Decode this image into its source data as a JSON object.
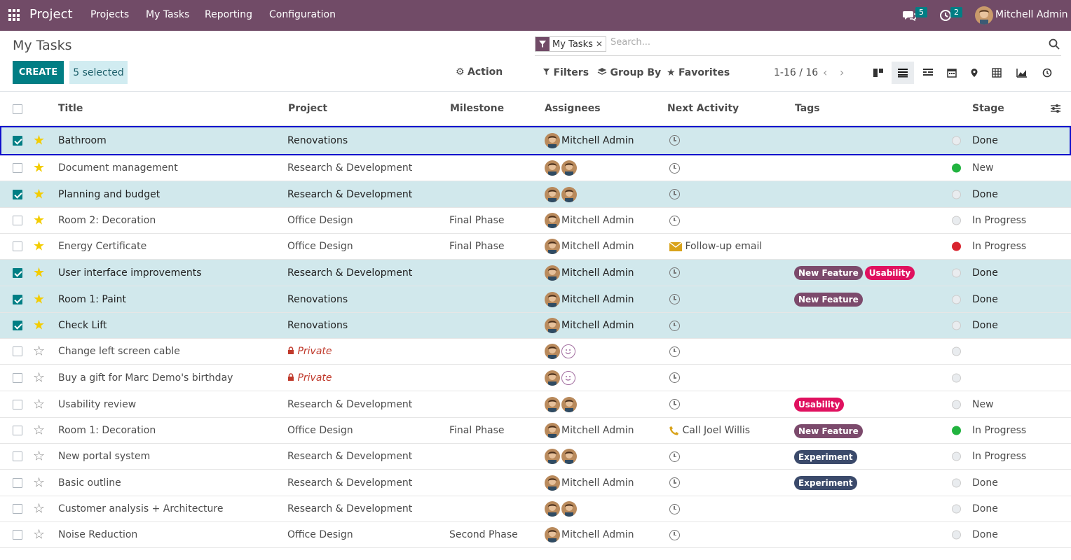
{
  "navbar": {
    "brand": "Project",
    "menus": [
      "Projects",
      "My Tasks",
      "Reporting",
      "Configuration"
    ],
    "messages_count": "5",
    "activities_count": "2",
    "user": "Mitchell Admin"
  },
  "control": {
    "title": "My Tasks",
    "create_label": "CREATE",
    "selected_label": "5 selected",
    "action_label": "Action",
    "facet_label": "My Tasks",
    "search_placeholder": "Search...",
    "filters_label": "Filters",
    "groupby_label": "Group By",
    "favorites_label": "Favorites",
    "pager": "1-16 / 16"
  },
  "columns": {
    "title": "Title",
    "project": "Project",
    "milestone": "Milestone",
    "assignees": "Assignees",
    "next_activity": "Next Activity",
    "tags": "Tags",
    "stage": "Stage"
  },
  "colors": {
    "brand": "#714b67",
    "accent": "#017e84",
    "tag_new_feature": "#7c4a6c",
    "tag_usability": "#e0115f",
    "tag_experiment": "#3b4a6b"
  },
  "rows": [
    {
      "selected": true,
      "starred": true,
      "title": "Bathroom",
      "project": "Renovations",
      "private": false,
      "milestone": "",
      "assignee_name": "Mitchell Admin",
      "assignee_count": 1,
      "activity_type": "clock",
      "activity": "",
      "tags": [],
      "status": "grey",
      "stage": "Done"
    },
    {
      "selected": false,
      "starred": true,
      "title": "Document management",
      "project": "Research & Development",
      "private": false,
      "milestone": "",
      "assignee_name": "",
      "assignee_count": 2,
      "activity_type": "clock",
      "activity": "",
      "tags": [],
      "status": "green",
      "stage": "New"
    },
    {
      "selected": true,
      "starred": true,
      "title": "Planning and budget",
      "project": "Research & Development",
      "private": false,
      "milestone": "",
      "assignee_name": "",
      "assignee_count": 2,
      "activity_type": "clock",
      "activity": "",
      "tags": [],
      "status": "grey",
      "stage": "Done"
    },
    {
      "selected": false,
      "starred": true,
      "title": "Room 2: Decoration",
      "project": "Office Design",
      "private": false,
      "milestone": "Final Phase",
      "assignee_name": "Mitchell Admin",
      "assignee_count": 1,
      "activity_type": "clock",
      "activity": "",
      "tags": [],
      "status": "grey",
      "stage": "In Progress"
    },
    {
      "selected": false,
      "starred": true,
      "title": "Energy Certificate",
      "project": "Office Design",
      "private": false,
      "milestone": "Final Phase",
      "assignee_name": "Mitchell Admin",
      "assignee_count": 1,
      "activity_type": "email",
      "activity": "Follow-up email",
      "tags": [],
      "status": "red",
      "stage": "In Progress"
    },
    {
      "selected": true,
      "starred": true,
      "title": "User interface improvements",
      "project": "Research & Development",
      "private": false,
      "milestone": "",
      "assignee_name": "Mitchell Admin",
      "assignee_count": 1,
      "activity_type": "clock",
      "activity": "",
      "tags": [
        "New Feature",
        "Usability"
      ],
      "status": "grey",
      "stage": "Done"
    },
    {
      "selected": true,
      "starred": true,
      "title": "Room 1: Paint",
      "project": "Renovations",
      "private": false,
      "milestone": "",
      "assignee_name": "Mitchell Admin",
      "assignee_count": 1,
      "activity_type": "clock",
      "activity": "",
      "tags": [
        "New Feature"
      ],
      "status": "grey",
      "stage": "Done"
    },
    {
      "selected": true,
      "starred": true,
      "title": "Check Lift",
      "project": "Renovations",
      "private": false,
      "milestone": "",
      "assignee_name": "Mitchell Admin",
      "assignee_count": 1,
      "activity_type": "clock",
      "activity": "",
      "tags": [],
      "status": "grey",
      "stage": "Done"
    },
    {
      "selected": false,
      "starred": false,
      "title": "Change left screen cable",
      "project": "Private",
      "private": true,
      "milestone": "",
      "assignee_name": "",
      "assignee_count": 2,
      "smiley": true,
      "activity_type": "clock",
      "activity": "",
      "tags": [],
      "status": "grey",
      "stage": ""
    },
    {
      "selected": false,
      "starred": false,
      "title": "Buy a gift for Marc Demo's birthday",
      "project": "Private",
      "private": true,
      "milestone": "",
      "assignee_name": "",
      "assignee_count": 2,
      "smiley": true,
      "activity_type": "clock",
      "activity": "",
      "tags": [],
      "status": "grey",
      "stage": ""
    },
    {
      "selected": false,
      "starred": false,
      "title": "Usability review",
      "project": "Research & Development",
      "private": false,
      "milestone": "",
      "assignee_name": "",
      "assignee_count": 2,
      "activity_type": "clock",
      "activity": "",
      "tags": [
        "Usability"
      ],
      "status": "grey",
      "stage": "New"
    },
    {
      "selected": false,
      "starred": false,
      "title": "Room 1: Decoration",
      "project": "Office Design",
      "private": false,
      "milestone": "Final Phase",
      "assignee_name": "Mitchell Admin",
      "assignee_count": 1,
      "activity_type": "phone",
      "activity": "Call Joel Willis",
      "tags": [
        "New Feature"
      ],
      "status": "green",
      "stage": "In Progress"
    },
    {
      "selected": false,
      "starred": false,
      "title": "New portal system",
      "project": "Research & Development",
      "private": false,
      "milestone": "",
      "assignee_name": "",
      "assignee_count": 2,
      "activity_type": "clock",
      "activity": "",
      "tags": [
        "Experiment"
      ],
      "status": "grey",
      "stage": "In Progress"
    },
    {
      "selected": false,
      "starred": false,
      "title": "Basic outline",
      "project": "Research & Development",
      "private": false,
      "milestone": "",
      "assignee_name": "Mitchell Admin",
      "assignee_count": 1,
      "activity_type": "clock",
      "activity": "",
      "tags": [
        "Experiment"
      ],
      "status": "grey",
      "stage": "Done"
    },
    {
      "selected": false,
      "starred": false,
      "title": "Customer analysis + Architecture",
      "project": "Research & Development",
      "private": false,
      "milestone": "",
      "assignee_name": "",
      "assignee_count": 2,
      "activity_type": "clock",
      "activity": "",
      "tags": [],
      "status": "grey",
      "stage": "Done"
    },
    {
      "selected": false,
      "starred": false,
      "title": "Noise Reduction",
      "project": "Office Design",
      "private": false,
      "milestone": "Second Phase",
      "assignee_name": "Mitchell Admin",
      "assignee_count": 1,
      "activity_type": "clock",
      "activity": "",
      "tags": [],
      "status": "grey",
      "stage": "Done"
    }
  ]
}
